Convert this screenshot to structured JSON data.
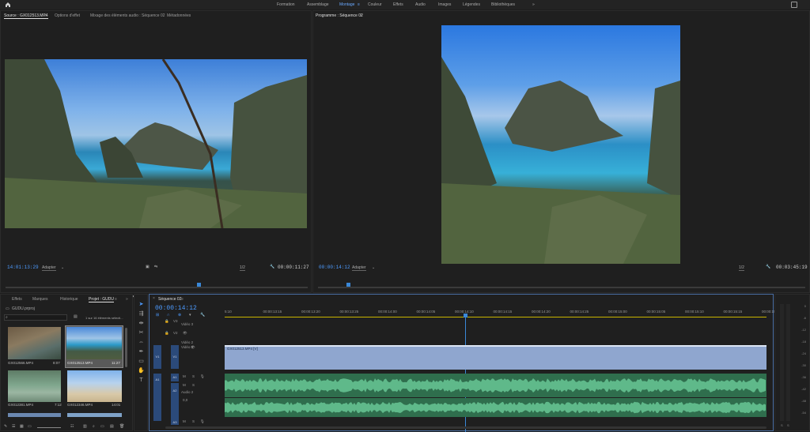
{
  "topbar": {
    "workspaces": [
      "Formation",
      "Assemblage",
      "Montage",
      "Couleur",
      "Effets",
      "Audio",
      "Images",
      "Légendes",
      "Bibliothèques"
    ],
    "active": "Montage",
    "more": "»"
  },
  "source": {
    "tabs": [
      "Source : GX012513.MP4",
      "Options d'effet",
      "Mixage des éléments audio : Séquence 02",
      "Métadonnées"
    ],
    "timecode_in": "14:01:13:29",
    "fit": "Adapter",
    "resolution": "1/2",
    "duration": "00:00:11:27"
  },
  "program": {
    "tab": "Programme : Séquence 02",
    "timecode": "00:00:14:12",
    "fit": "Adapter",
    "resolution": "1/2",
    "duration": "00:03:45:19"
  },
  "project": {
    "tabs": [
      "Effets",
      "Marques",
      "Historique",
      "Projet : GUDU"
    ],
    "file": "GUDU.prproj",
    "selection_info": "1 sur 16 éléments sélecti...",
    "clips": [
      {
        "name": "GX012566.MP4",
        "dur": "8:07"
      },
      {
        "name": "GX012513.MP4",
        "dur": "11:27"
      },
      {
        "name": "GX012381.MP4",
        "dur": "7:12"
      },
      {
        "name": "GX012346.MP4",
        "dur": "14:01"
      }
    ]
  },
  "timeline": {
    "tab": "Séquence 02",
    "timecode": "00:00:14:12",
    "ruler": [
      "5:10",
      "00:00:13:15",
      "00:00:13:20",
      "00:00:13:25",
      "00:00:14:00",
      "00:00:14:05",
      "00:00:14:10",
      "00:00:14:15",
      "00:00:14:20",
      "00:00:14:25",
      "00:00:15:00",
      "00:00:15:05",
      "00:00:15:10",
      "00:00:15:15",
      "00:00:15:2"
    ],
    "tracks": {
      "v3": "V3",
      "v3_name": "Vidéo 3",
      "v2": "V2",
      "v2_name": "Vidéo 2",
      "v1": "V1",
      "v1_name": "Vidéo 1",
      "a1": "A1",
      "a2": "A2",
      "a2_name": "Audio 2",
      "a3": "A3"
    },
    "video_clip": "GX012513.MP4 [V]",
    "audio_value": "0,0"
  },
  "meter": {
    "labels": [
      "0",
      "-6",
      "-12",
      "-18",
      "-24",
      "-30",
      "-36",
      "-42",
      "-48",
      "-54"
    ],
    "bottom": [
      "S",
      "S"
    ]
  },
  "colors": {
    "accent": "#4d9bff",
    "video_clip": "#8fa6cf",
    "audio_clip": "#5fb98a",
    "playhead": "#3a88d8"
  }
}
